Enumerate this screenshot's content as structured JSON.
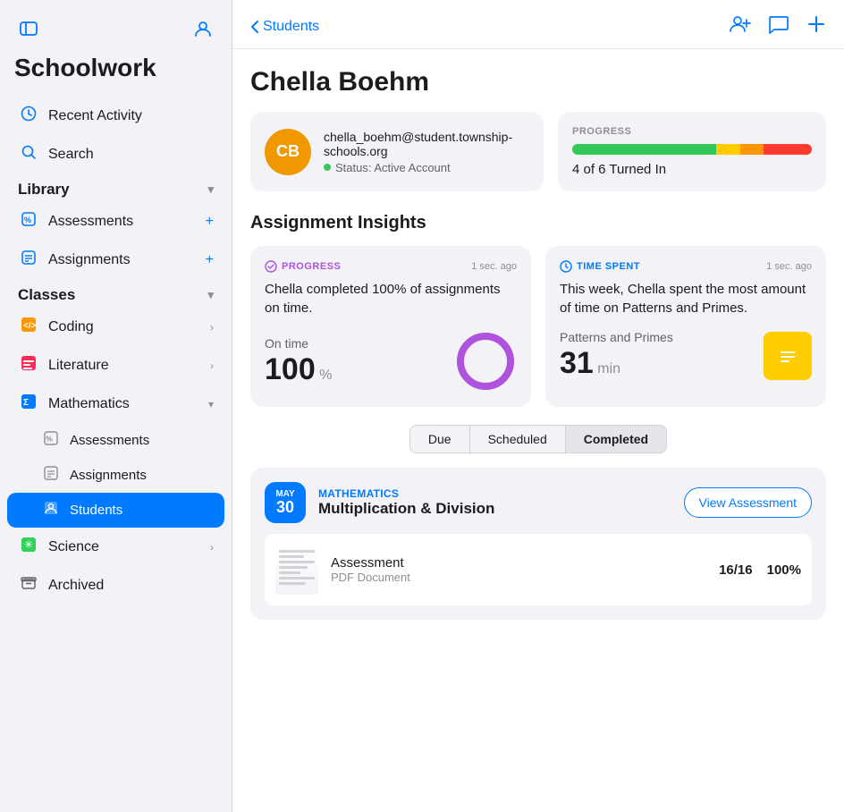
{
  "app": {
    "title": "Schoolwork"
  },
  "sidebar": {
    "collapse_icon": "⊟",
    "profile_icon": "👤",
    "nav_items": [
      {
        "id": "recent-activity",
        "label": "Recent Activity",
        "icon": "🕐",
        "type": "nav"
      },
      {
        "id": "search",
        "label": "Search",
        "icon": "🔍",
        "type": "nav"
      }
    ],
    "library_section": {
      "label": "Library",
      "items": [
        {
          "id": "assessments",
          "label": "Assessments",
          "icon": "%"
        },
        {
          "id": "assignments",
          "label": "Assignments",
          "icon": "≡"
        }
      ]
    },
    "classes_section": {
      "label": "Classes",
      "items": [
        {
          "id": "coding",
          "label": "Coding",
          "icon": "🟧"
        },
        {
          "id": "literature",
          "label": "Literature",
          "icon": "📊"
        },
        {
          "id": "mathematics",
          "label": "Mathematics",
          "expanded": true,
          "sub_items": [
            {
              "id": "math-assessments",
              "label": "Assessments",
              "icon": "%"
            },
            {
              "id": "math-assignments",
              "label": "Assignments",
              "icon": "≡"
            },
            {
              "id": "math-students",
              "label": "Students",
              "icon": "🗂",
              "active": true
            }
          ]
        },
        {
          "id": "science",
          "label": "Science",
          "icon": "✳"
        }
      ]
    },
    "archived": {
      "label": "Archived",
      "icon": "🗄"
    }
  },
  "main": {
    "back_label": "Students",
    "student_name": "Chella Boehm",
    "profile": {
      "initials": "CB",
      "email": "chella_boehm@student.township-schools.org",
      "status_label": "Status: Active Account"
    },
    "progress": {
      "label": "PROGRESS",
      "count_label": "4 of 6 Turned In",
      "green_pct": 60,
      "yellow_pct": 10,
      "orange_pct": 10,
      "red_pct": 20
    },
    "insights": {
      "title": "Assignment Insights",
      "progress_card": {
        "tag": "PROGRESS",
        "timestamp": "1 sec. ago",
        "text": "Chella completed 100% of assignments on time.",
        "metric_label": "On time",
        "metric_value": "100",
        "metric_unit": "%"
      },
      "time_card": {
        "tag": "TIME SPENT",
        "timestamp": "1 sec. ago",
        "text": "This week, Chella spent the most amount of time on Patterns and Primes.",
        "metric_label": "Patterns and Primes",
        "metric_value": "31",
        "metric_unit": "min"
      }
    },
    "filter_tabs": [
      {
        "id": "due",
        "label": "Due"
      },
      {
        "id": "scheduled",
        "label": "Scheduled"
      },
      {
        "id": "completed",
        "label": "Completed",
        "active": true
      }
    ],
    "assignments": [
      {
        "date_month": "MAY",
        "date_day": "30",
        "class_label": "MATHEMATICS",
        "name": "Multiplication & Division",
        "view_button": "View Assessment",
        "detail": {
          "title": "Assessment",
          "type": "PDF Document",
          "score": "16/16",
          "percent": "100%"
        }
      }
    ],
    "header_actions": {
      "add_student": "add-student-icon",
      "message": "message-icon",
      "add": "add-icon"
    }
  }
}
